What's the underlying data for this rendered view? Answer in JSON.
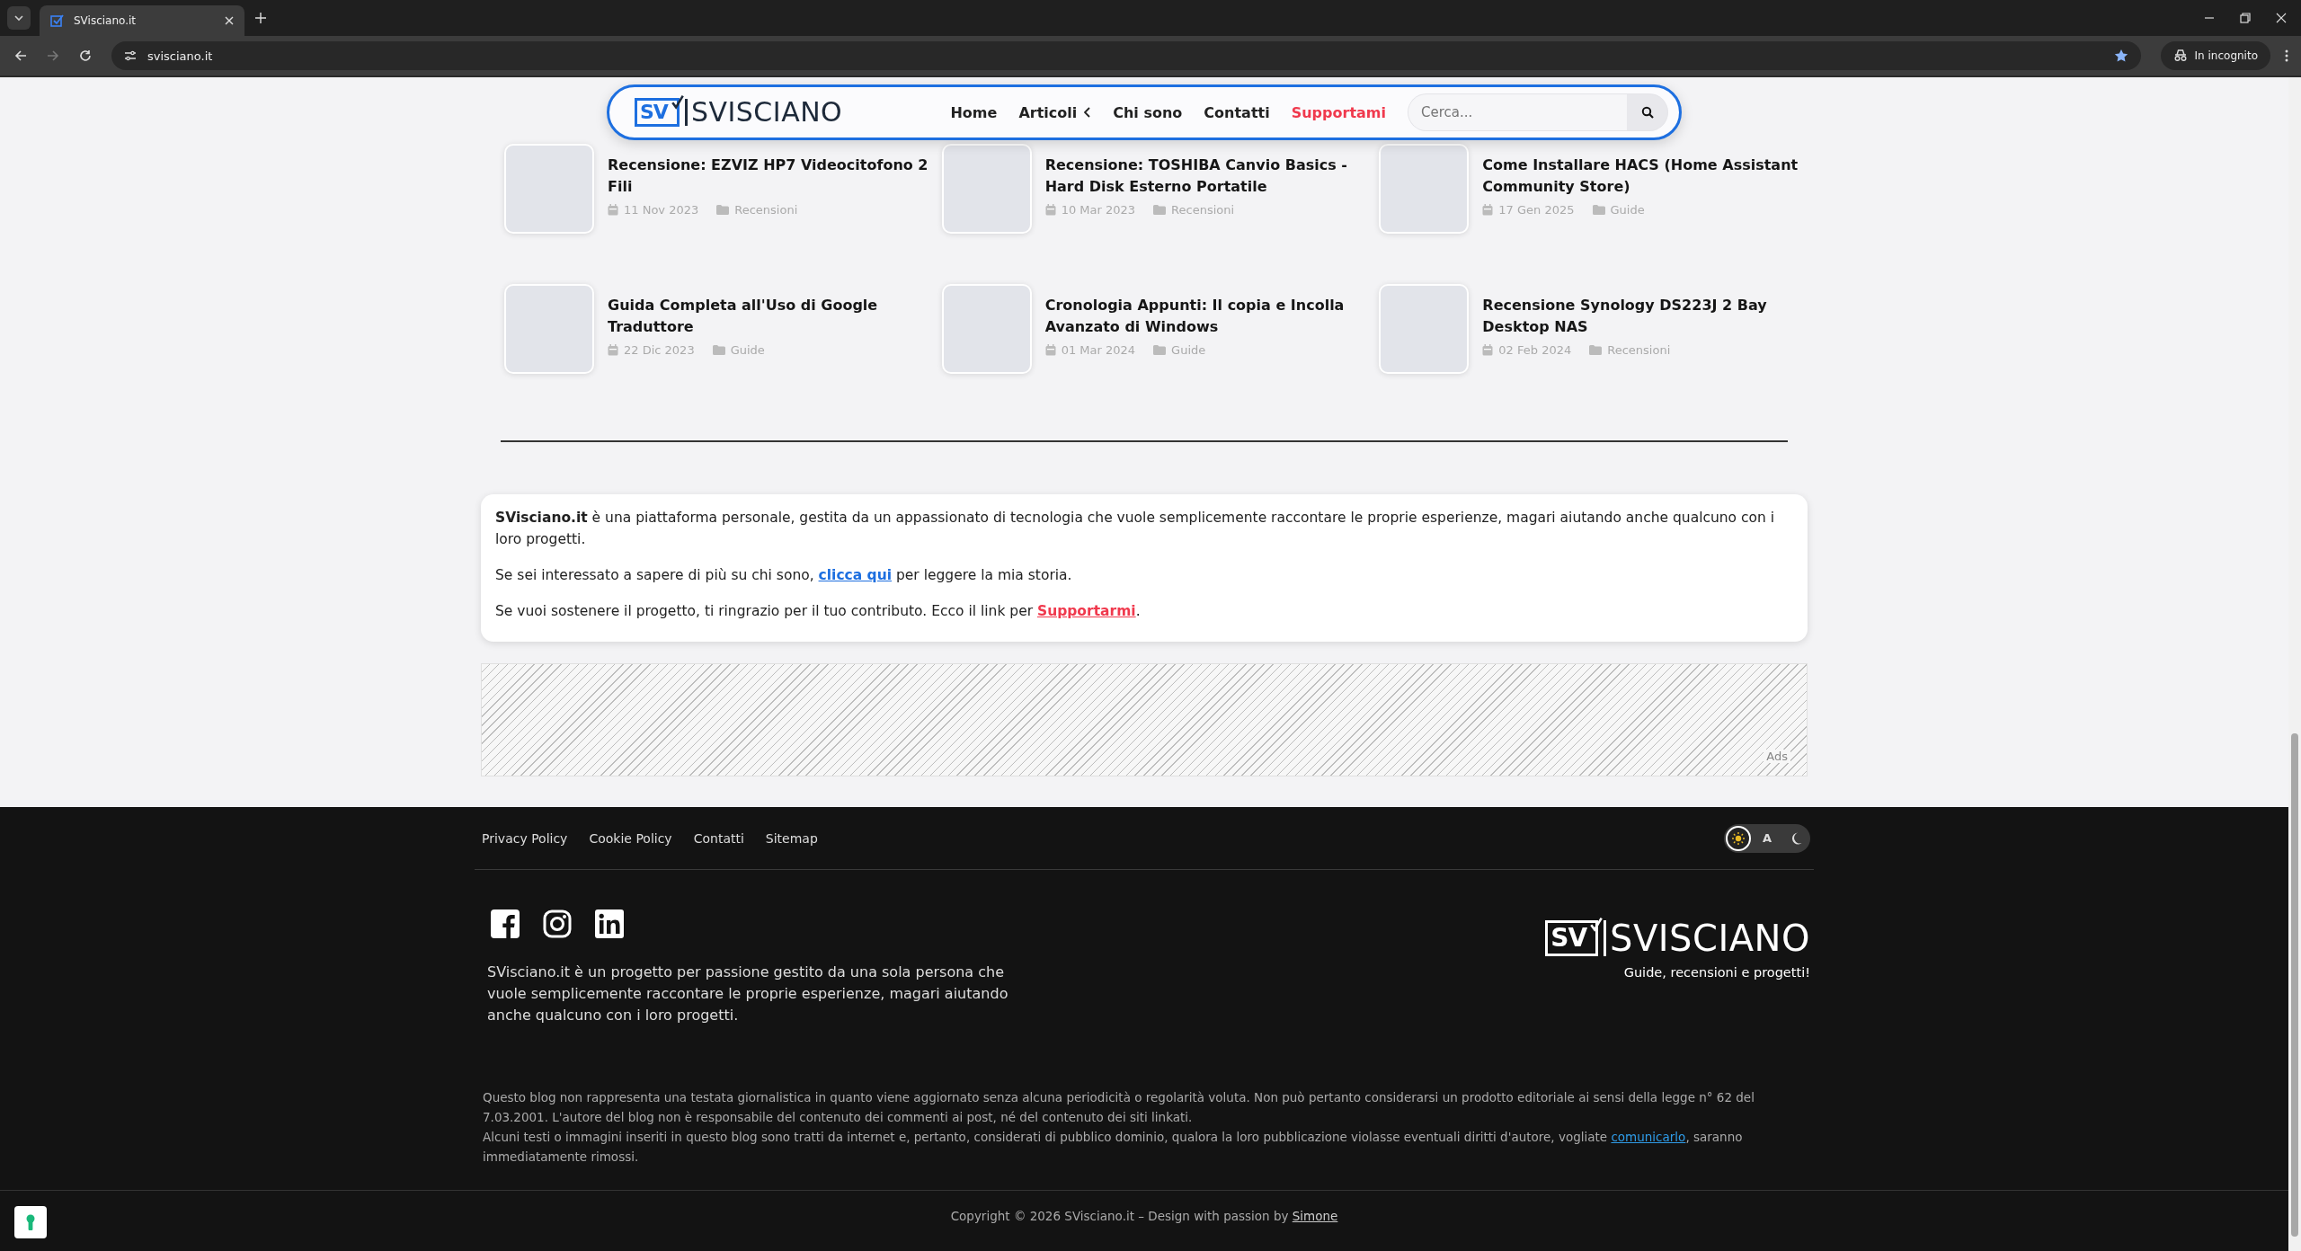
{
  "browser": {
    "tab_title": "SVisciano.it",
    "url": "svisciano.it",
    "incognito_label": "In incognito"
  },
  "header": {
    "logo_mark": "SV",
    "logo_text": "SVISCIANO",
    "nav": [
      {
        "label": "Home",
        "has_submenu": false,
        "highlighted": false
      },
      {
        "label": "Articoli",
        "has_submenu": true,
        "highlighted": false
      },
      {
        "label": "Chi sono",
        "has_submenu": false,
        "highlighted": false
      },
      {
        "label": "Contatti",
        "has_submenu": false,
        "highlighted": false
      },
      {
        "label": "Supportami",
        "has_submenu": false,
        "highlighted": true
      }
    ],
    "search": {
      "placeholder": "Cerca..."
    }
  },
  "articles": [
    {
      "title": "Recensione: EZVIZ HP7 Videocitofono 2 Fili",
      "date": "11 Nov 2023",
      "category": "Recensioni"
    },
    {
      "title": "Recensione: TOSHIBA Canvio Basics - Hard Disk Esterno Portatile",
      "date": "10 Mar 2023",
      "category": "Recensioni"
    },
    {
      "title": "Come Installare HACS (Home Assistant Community Store)",
      "date": "17 Gen 2025",
      "category": "Guide"
    },
    {
      "title": "Guida Completa all'Uso di Google Traduttore",
      "date": "22 Dic 2023",
      "category": "Guide"
    },
    {
      "title": "Cronologia Appunti: Il copia e Incolla Avanzato di Windows",
      "date": "01 Mar 2024",
      "category": "Guide"
    },
    {
      "title": "Recensione Synology DS223J 2 Bay Desktop NAS",
      "date": "02 Feb 2024",
      "category": "Recensioni"
    }
  ],
  "about": [
    {
      "text": "**SVisciano.it** è una piattaforma personale, gestita da un appassionato di tecnologia che vuole semplicemente raccontare le proprie esperienze, magari aiutando anche qualcuno con i loro progetti."
    },
    {
      "text": "Se sei interessato a sapere di più su chi sono, ",
      "link": "clicca qui",
      "color": "#1d6fe0",
      "after": " per leggere la mia storia."
    },
    {
      "text": "Se vuoi sostenere il progetto, ti ringrazio per il tuo contributo. Ecco il link per ",
      "link": "Supportarmi",
      "color": "#f0394d",
      "after": "."
    }
  ],
  "ad": {
    "label": "Ads"
  },
  "footer": {
    "links": [
      "Privacy Policy",
      "Cookie Policy",
      "Contatti",
      "Sitemap"
    ],
    "theme_options": [
      {
        "kind": "light",
        "selected": true
      },
      {
        "kind": "auto",
        "label": "A",
        "selected": false
      },
      {
        "kind": "dark",
        "selected": false
      }
    ],
    "social": [
      {
        "kind": "facebook"
      },
      {
        "kind": "instagram"
      },
      {
        "kind": "linkedin"
      }
    ],
    "about": "SVisciano.it è un progetto per passione gestito da una sola persona che vuole semplicemente raccontare le proprie esperienze, magari aiutando anche qualcuno con i loro progetti.",
    "logo_mark": "SV",
    "logo_text": "SVISCIANO",
    "tagline": "Guide, recensioni e progetti!",
    "disclaimer": [
      {
        "text": "Questo blog non rappresenta una testata giornalistica in quanto viene aggiornato senza alcuna periodicità o regolarità voluta. Non può pertanto considerarsi un prodotto editoriale ai sensi della legge n° 62 del 7.03.2001. L'autore del blog non è responsabile del contenuto dei commenti ai post, né del contenuto dei siti linkati."
      },
      {
        "text": "Alcuni testi o immagini inseriti in questo blog sono tratti da internet e, pertanto, considerati di pubblico dominio, qualora la loro pubblicazione violasse eventuali diritti d'autore, vogliate ",
        "link": "comunicarlo",
        "after": ", saranno immediatamente rimossi."
      }
    ],
    "copyright": {
      "text": "Copyright © 2026 SVisciano.it – Design with passion by ",
      "link": "Simone"
    }
  }
}
